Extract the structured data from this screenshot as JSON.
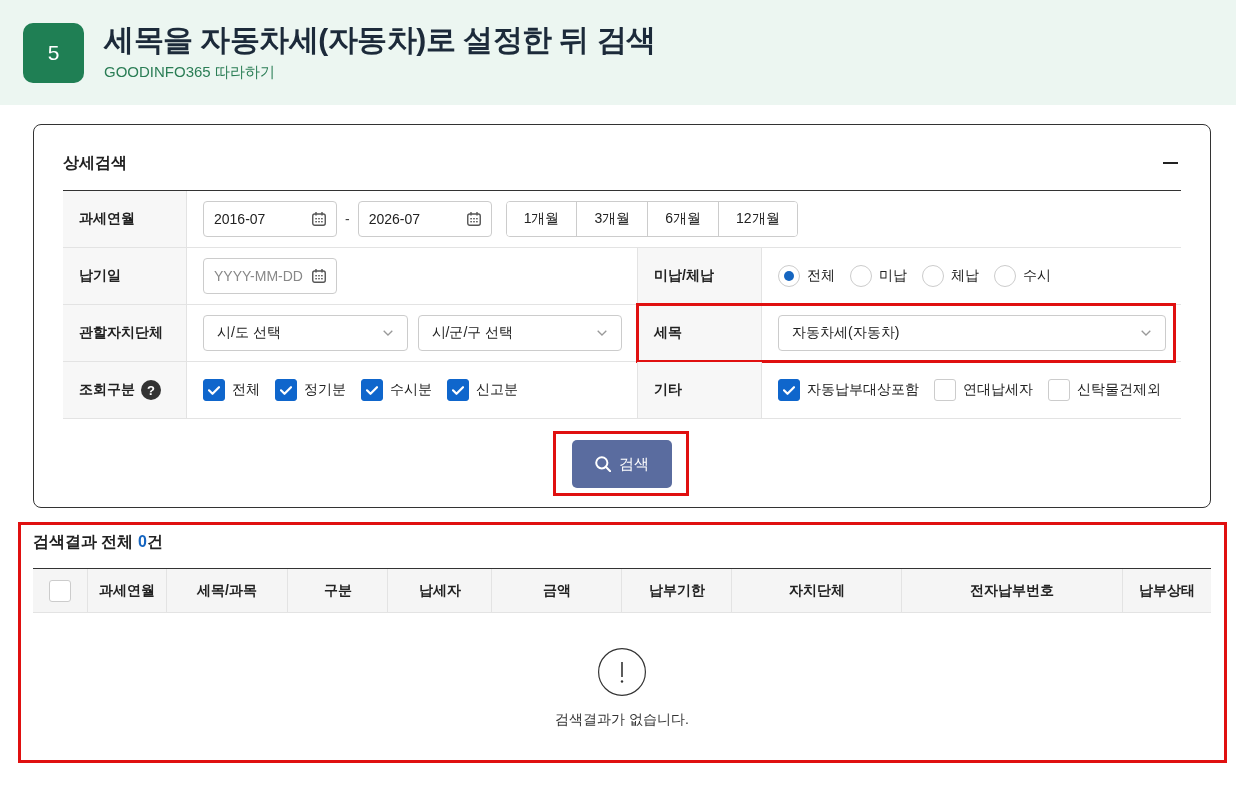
{
  "header": {
    "step": "5",
    "title": "세목을 자동차세(자동차)로 설정한 뒤 검색",
    "subtitle": "GOODINFO365 따라하기"
  },
  "search_panel": {
    "title": "상세검색",
    "expanded": true,
    "rows": [
      {
        "cells": [
          {
            "kind": "month_range",
            "label": "과세연월",
            "from": "2016-07",
            "separator": "-",
            "to": "2026-07",
            "periods": [
              {
                "label": "1개월",
                "selected": false
              },
              {
                "label": "3개월",
                "selected": false
              },
              {
                "label": "6개월",
                "selected": false
              },
              {
                "label": "12개월",
                "selected": false
              }
            ]
          }
        ]
      },
      {
        "cells": [
          {
            "kind": "date",
            "label": "납기일",
            "placeholder": "YYYY-MM-DD"
          },
          {
            "kind": "radios",
            "label": "미납/체납",
            "options": [
              {
                "label": "전체",
                "selected": true
              },
              {
                "label": "미납",
                "selected": false
              },
              {
                "label": "체납",
                "selected": false
              },
              {
                "label": "수시",
                "selected": false
              }
            ]
          }
        ]
      },
      {
        "cells": [
          {
            "kind": "selects",
            "label": "관할자치단체",
            "selects": [
              {
                "value": "시/도 선택"
              },
              {
                "value": "시/군/구 선택"
              }
            ]
          },
          {
            "kind": "selects",
            "label": "세목",
            "highlighted": true,
            "selects": [
              {
                "value": "자동차세(자동차)"
              }
            ]
          }
        ]
      },
      {
        "cells": [
          {
            "kind": "checkboxes",
            "label": "조회구분",
            "help": "?",
            "options": [
              {
                "label": "전체",
                "checked": true
              },
              {
                "label": "정기분",
                "checked": true
              },
              {
                "label": "수시분",
                "checked": true
              },
              {
                "label": "신고분",
                "checked": true
              }
            ]
          },
          {
            "kind": "checkboxes",
            "label": "기타",
            "options": [
              {
                "label": "자동납부대상포함",
                "checked": true
              },
              {
                "label": "연대납세자",
                "checked": false
              },
              {
                "label": "신탁물건제외",
                "checked": false
              }
            ]
          }
        ]
      }
    ]
  },
  "search_button": {
    "label": "검색",
    "highlighted": true
  },
  "results": {
    "highlighted": true,
    "title": "검색결과 전체",
    "count": "0",
    "count_unit": "건",
    "select_all": {
      "checked": false
    },
    "columns": [
      "과세연월",
      "세목/과목",
      "구분",
      "납세자",
      "금액",
      "납부기한",
      "자치단체",
      "전자납부번호",
      "납부상태"
    ],
    "empty_message": "검색결과가 없습니다."
  }
}
